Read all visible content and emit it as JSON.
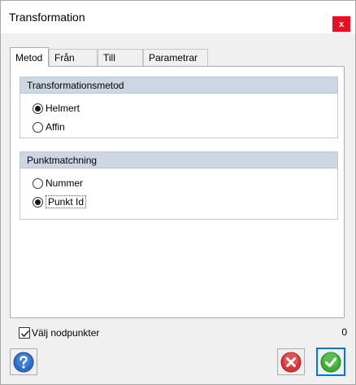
{
  "window": {
    "title": "Transformation",
    "close_label": "x"
  },
  "tabs": [
    {
      "label": "Metod",
      "active": true
    },
    {
      "label": "Från",
      "active": false
    },
    {
      "label": "Till",
      "active": false
    },
    {
      "label": "Parametrar",
      "active": false
    }
  ],
  "transformation_group": {
    "title": "Transformationsmetod",
    "options": [
      {
        "label": "Helmert",
        "checked": true
      },
      {
        "label": "Affin",
        "checked": false
      }
    ]
  },
  "matching_group": {
    "title": "Punktmatchning",
    "options": [
      {
        "label": "Nummer",
        "checked": false
      },
      {
        "label": "Punkt Id",
        "checked": true
      }
    ]
  },
  "footer": {
    "checkbox_label": "Välj nodpunkter",
    "checkbox_checked": true,
    "count": "0"
  },
  "icons": {
    "help": "help-icon",
    "cancel": "cancel-icon",
    "ok": "ok-icon"
  },
  "colors": {
    "close": "#e81123",
    "group_header": "#cdd7e3",
    "focus_border": "#0078d7",
    "help_blue": "#2b6cc8",
    "cancel_red": "#d9343a",
    "ok_green": "#3fae37"
  }
}
